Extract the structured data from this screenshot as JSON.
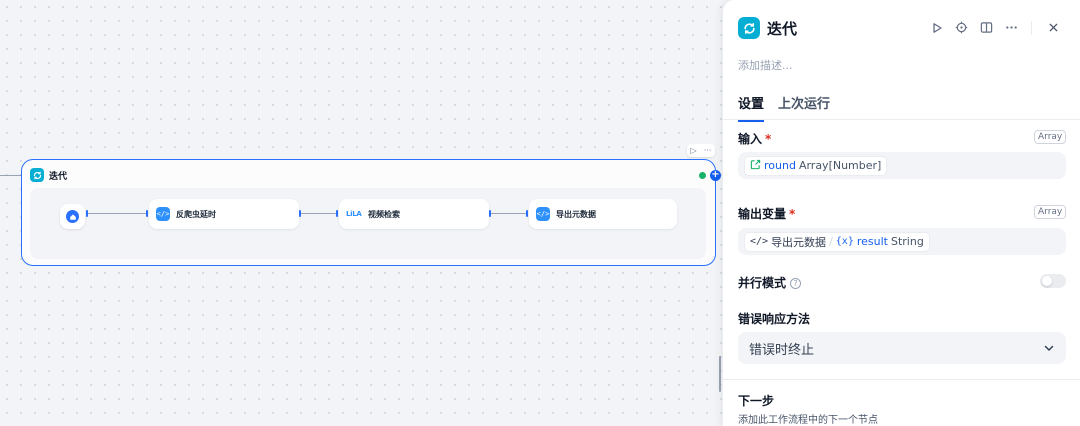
{
  "canvas": {
    "iteration_node": {
      "title": "迭代"
    },
    "sub_nodes": [
      {
        "label": "反爬虫延时",
        "icon": "code-icon"
      },
      {
        "label": "视频检索",
        "icon": "brand-logo-icon",
        "icon_text": "LiLA"
      },
      {
        "label": "导出元数据",
        "icon": "code-icon"
      }
    ],
    "start_node": {
      "icon": "home-icon"
    },
    "mini_toolbar": {
      "run_glyph": "▷",
      "more_glyph": "···"
    },
    "add_glyph": "+"
  },
  "panel": {
    "title": "迭代",
    "description_placeholder": "添加描述...",
    "tabs": [
      {
        "label": "设置",
        "active": true
      },
      {
        "label": "上次运行",
        "active": false
      }
    ],
    "input": {
      "label": "输入",
      "required_mark": "*",
      "type_badge": "Array",
      "variable": {
        "name": "round",
        "type": "Array[Number]"
      }
    },
    "output": {
      "label": "输出变量",
      "required_mark": "*",
      "type_badge": "Array",
      "source_node": "导出元数据",
      "separator": "/",
      "var_glyph": "{x}",
      "variable": {
        "name": "result",
        "type": "String"
      }
    },
    "parallel": {
      "label": "并行模式",
      "help_glyph": "?",
      "enabled": false
    },
    "error_handling": {
      "label": "错误响应方法",
      "value": "错误时终止"
    },
    "next_step": {
      "title": "下一步",
      "description": "添加此工作流程中的下一个节点"
    }
  },
  "colors": {
    "accent": "#155eef",
    "iteration_icon": "#06aed4",
    "code_icon": "#2e90fa",
    "success": "#17b26a",
    "required": "#d92d20"
  }
}
